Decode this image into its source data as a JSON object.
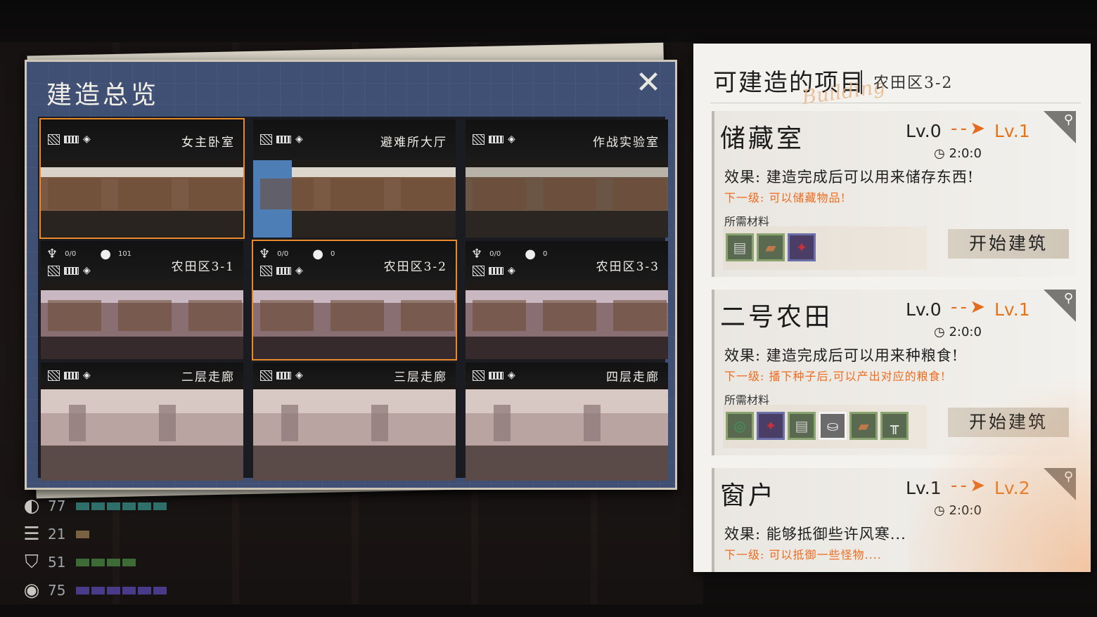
{
  "overview": {
    "title": "建造总览",
    "close": "✕",
    "rooms": [
      {
        "name": "女主卧室"
      },
      {
        "name": "避难所大厅"
      },
      {
        "name": "作战实验室"
      },
      {
        "name": "农田区3-1",
        "plants": "0/0",
        "water": "101"
      },
      {
        "name": "农田区3-2",
        "plants": "0/0",
        "water": "0"
      },
      {
        "name": "农田区3-3",
        "plants": "0/0",
        "water": "0"
      },
      {
        "name": "二层走廊"
      },
      {
        "name": "三层走廊"
      },
      {
        "name": "四层走廊"
      }
    ],
    "selected_room": "农田区3-2"
  },
  "stats": [
    {
      "icon": "water-drop-icon",
      "value": "77",
      "filled": 6,
      "color": "#2f6f6a"
    },
    {
      "icon": "food-icon",
      "value": "21",
      "filled": 1,
      "color": "#7a6141"
    },
    {
      "icon": "clothes-icon",
      "value": "51",
      "filled": 4,
      "color": "#3c6b36"
    },
    {
      "icon": "eye-icon",
      "value": "75",
      "filled": 6,
      "color": "#4a3a8a"
    }
  ],
  "build": {
    "title": "可建造的项目",
    "watermark": "Building",
    "area": "农田区3-2",
    "materials_label": "所需材料",
    "items": [
      {
        "name": "储藏室",
        "lv_from": "Lv.0",
        "lv_to": "Lv.1",
        "time": "2:0:0",
        "effect": "效果: 建造完成后可以用来储存东西!",
        "next": "下一级: 可以储藏物品!",
        "button": "开始建筑"
      },
      {
        "name": "二号农田",
        "lv_from": "Lv.0",
        "lv_to": "Lv.1",
        "time": "2:0:0",
        "effect": "效果: 建造完成后可以用来种粮食!",
        "next": "下一级: 播下种子后,可以产出对应的粮食!",
        "button": "开始建筑"
      },
      {
        "name": "窗户",
        "lv_from": "Lv.1",
        "lv_to": "Lv.2",
        "time": "2:0:0",
        "effect": "效果: 能够抵御些许风寒...",
        "next": "下一级: 可以抵御一些怪物...."
      }
    ]
  },
  "colors": {
    "accent": "#e98a2a",
    "panel_blue": "#3f5074",
    "orange_text": "#ef6c1e"
  }
}
